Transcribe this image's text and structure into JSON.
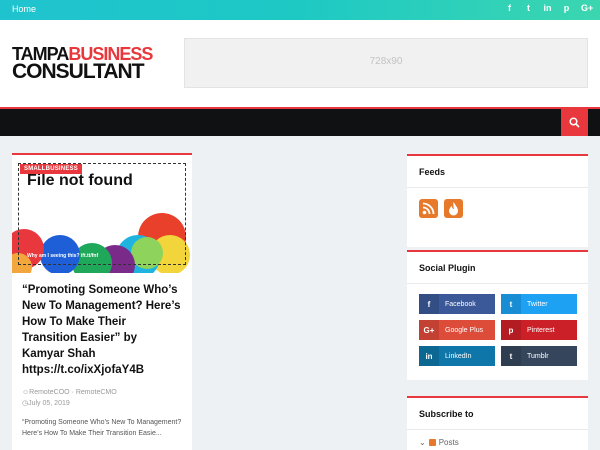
{
  "topbar": {
    "home": "Home",
    "socials": [
      {
        "icon": "facebook-icon",
        "glyph": "f"
      },
      {
        "icon": "twitter-icon",
        "glyph": "t"
      },
      {
        "icon": "linkedin-icon",
        "glyph": "in"
      },
      {
        "icon": "pinterest-icon",
        "glyph": "p"
      },
      {
        "icon": "google-plus-icon",
        "glyph": "G+"
      }
    ]
  },
  "header": {
    "logo_tampa": "TAMPA",
    "logo_business": "BUSINESS",
    "logo_consultant": "CONSULTANT",
    "ad_text": "728x90"
  },
  "post": {
    "category": "SMALLBUSINESS",
    "thumb_text": "File not found",
    "thumb_subtext": "Why am I seeing this? ift.tt/fnf",
    "title": "“Promoting Someone Who’s New To Management? Here’s How To Make Their Transition Easier” by Kamyar Shah https://t.co/ixXjofaY4B",
    "author": "RemoteCOO · RemoteCMO",
    "date": "July 05, 2019",
    "excerpt": "“Promoting Someone Who’s New To Management? Here’s How To Make Their Transition Easie..."
  },
  "widgets": {
    "feeds_title": "Feeds",
    "social_title": "Social Plugin",
    "subscribe_title": "Subscribe to",
    "subscribe_item": "Posts",
    "social_buttons": [
      {
        "label": "Facebook",
        "glyph": "f",
        "color": "#3b5998"
      },
      {
        "label": "Twitter",
        "glyph": "t",
        "color": "#1da1f2"
      },
      {
        "label": "Google Plus",
        "glyph": "G+",
        "color": "#dd4b39"
      },
      {
        "label": "Pinterest",
        "glyph": "p",
        "color": "#cb2027"
      },
      {
        "label": "LinkedIn",
        "glyph": "in",
        "color": "#0e76a8"
      },
      {
        "label": "Tumblr",
        "glyph": "t",
        "color": "#35465c"
      }
    ]
  },
  "colors": {
    "accent": "#e8383d",
    "topbar": "#1fc3cf",
    "nav": "#0f1112",
    "feed": "#e7792b"
  }
}
